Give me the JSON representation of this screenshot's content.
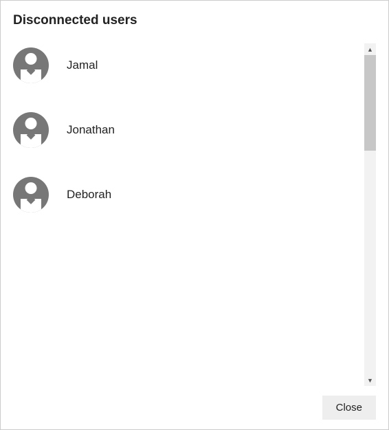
{
  "dialog": {
    "title": "Disconnected users",
    "close_label": "Close"
  },
  "users": [
    {
      "name": "Jamal"
    },
    {
      "name": "Jonathan"
    },
    {
      "name": "Deborah"
    }
  ]
}
